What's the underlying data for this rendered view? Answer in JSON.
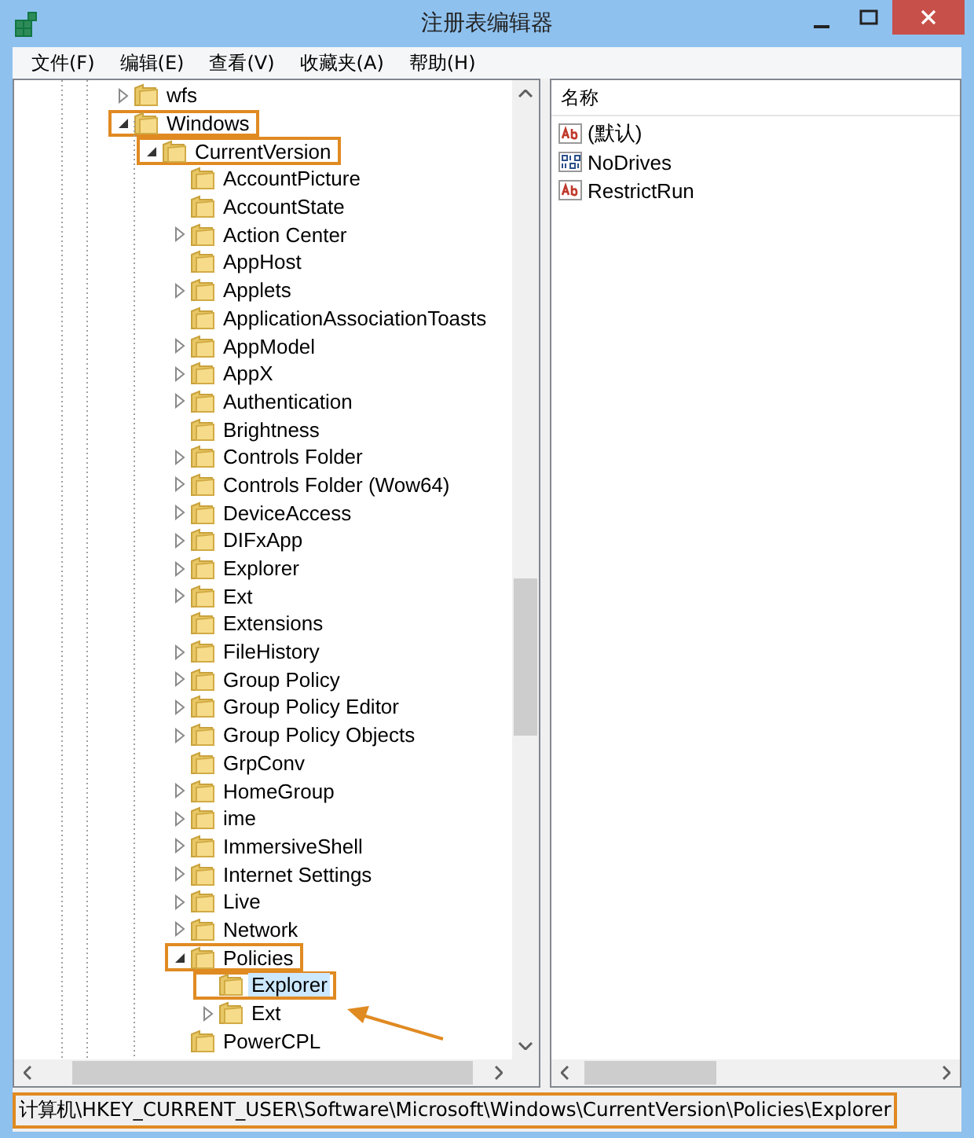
{
  "window": {
    "title": "注册表编辑器"
  },
  "menu": [
    "文件(F)",
    "编辑(E)",
    "查看(V)",
    "收藏夹(A)",
    "帮助(H)"
  ],
  "tree": [
    {
      "name": "wfs",
      "expanded": false,
      "selected": false,
      "annotated": false
    },
    {
      "name": "Windows",
      "expanded": true,
      "selected": false,
      "annotated": true,
      "children": [
        {
          "name": "CurrentVersion",
          "expanded": true,
          "selected": false,
          "annotated": true,
          "children": [
            {
              "name": "AccountPicture",
              "selected": false,
              "annotated": false
            },
            {
              "name": "AccountState",
              "selected": false,
              "annotated": false
            },
            {
              "name": "Action Center",
              "expanded": false,
              "selected": false,
              "annotated": false
            },
            {
              "name": "AppHost",
              "selected": false,
              "annotated": false
            },
            {
              "name": "Applets",
              "expanded": false,
              "selected": false,
              "annotated": false
            },
            {
              "name": "ApplicationAssociationToasts",
              "selected": false,
              "annotated": false
            },
            {
              "name": "AppModel",
              "expanded": false,
              "selected": false,
              "annotated": false
            },
            {
              "name": "AppX",
              "expanded": false,
              "selected": false,
              "annotated": false
            },
            {
              "name": "Authentication",
              "expanded": false,
              "selected": false,
              "annotated": false
            },
            {
              "name": "Brightness",
              "selected": false,
              "annotated": false
            },
            {
              "name": "Controls Folder",
              "expanded": false,
              "selected": false,
              "annotated": false
            },
            {
              "name": "Controls Folder (Wow64)",
              "expanded": false,
              "selected": false,
              "annotated": false
            },
            {
              "name": "DeviceAccess",
              "expanded": false,
              "selected": false,
              "annotated": false
            },
            {
              "name": "DIFxApp",
              "expanded": false,
              "selected": false,
              "annotated": false
            },
            {
              "name": "Explorer",
              "expanded": false,
              "selected": false,
              "annotated": false
            },
            {
              "name": "Ext",
              "expanded": false,
              "selected": false,
              "annotated": false
            },
            {
              "name": "Extensions",
              "selected": false,
              "annotated": false
            },
            {
              "name": "FileHistory",
              "expanded": false,
              "selected": false,
              "annotated": false
            },
            {
              "name": "Group Policy",
              "expanded": false,
              "selected": false,
              "annotated": false
            },
            {
              "name": "Group Policy Editor",
              "expanded": false,
              "selected": false,
              "annotated": false
            },
            {
              "name": "Group Policy Objects",
              "expanded": false,
              "selected": false,
              "annotated": false
            },
            {
              "name": "GrpConv",
              "selected": false,
              "annotated": false
            },
            {
              "name": "HomeGroup",
              "expanded": false,
              "selected": false,
              "annotated": false
            },
            {
              "name": "ime",
              "expanded": false,
              "selected": false,
              "annotated": false
            },
            {
              "name": "ImmersiveShell",
              "expanded": false,
              "selected": false,
              "annotated": false
            },
            {
              "name": "Internet Settings",
              "expanded": false,
              "selected": false,
              "annotated": false
            },
            {
              "name": "Live",
              "expanded": false,
              "selected": false,
              "annotated": false
            },
            {
              "name": "Network",
              "expanded": false,
              "selected": false,
              "annotated": false
            },
            {
              "name": "Policies",
              "expanded": true,
              "selected": false,
              "annotated": true,
              "children": [
                {
                  "name": "Explorer",
                  "selected": true,
                  "annotated": true
                },
                {
                  "name": "Ext",
                  "expanded": false,
                  "selected": false,
                  "annotated": false
                }
              ]
            },
            {
              "name": "PowerCPL",
              "selected": false,
              "annotated": false
            }
          ]
        }
      ]
    }
  ],
  "values": {
    "column": "名称",
    "rows": [
      {
        "name": "(默认)",
        "kind": "string"
      },
      {
        "name": "NoDrives",
        "kind": "binary"
      },
      {
        "name": "RestrictRun",
        "kind": "string"
      }
    ]
  },
  "status_bar": {
    "path": "计算机\\HKEY_CURRENT_USER\\Software\\Microsoft\\Windows\\CurrentVersion\\Policies\\Explorer",
    "annotated": true
  }
}
